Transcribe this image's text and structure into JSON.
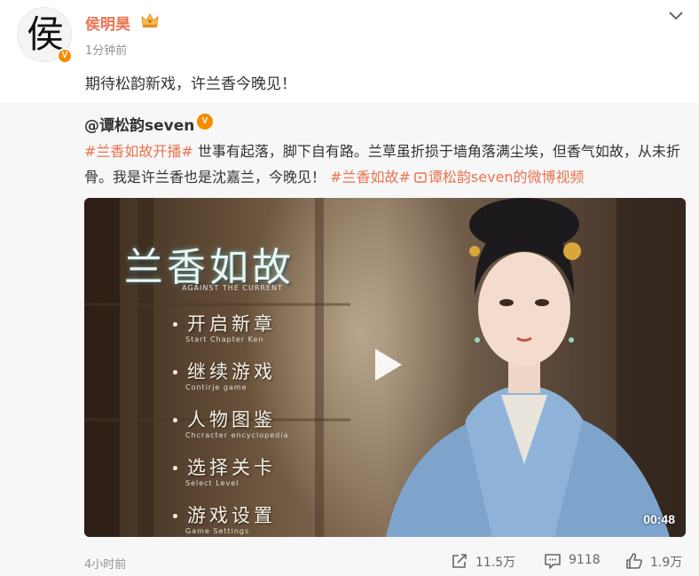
{
  "post": {
    "avatar_char": "侯",
    "author": "侯明昊",
    "verified_badge": "V",
    "time": "1分钟前",
    "text": "期待松韵新戏，许兰香今晚见！"
  },
  "repost": {
    "author": "@谭松韵seven",
    "verified_badge": "V",
    "topic1": "#兰香如故开播#",
    "body": " 世事有起落，脚下自有路。兰草虽折损于墙角落满尘埃，但香气如故，从未折骨。我是许兰香也是沈嘉兰，今晚见！ ",
    "topic2": "#兰香如故#",
    "video_link": "谭松韵seven的微博视频",
    "video": {
      "title": "兰香如故",
      "subtitle": "AGAINST THE CURRENT",
      "menu": [
        {
          "label": "开启新章",
          "sub": "Start Chapter Ken"
        },
        {
          "label": "继续游戏",
          "sub": "Contirje game"
        },
        {
          "label": "人物图鉴",
          "sub": "Chcracter encyclopedia"
        },
        {
          "label": "选择关卡",
          "sub": "Select Level"
        },
        {
          "label": "游戏设置",
          "sub": "Game Settings"
        }
      ],
      "duration": "00:48"
    },
    "time": "4小时前",
    "stats": {
      "reposts": "11.5万",
      "comments": "9118",
      "likes": "1.9万"
    }
  },
  "colors": {
    "accent": "#eb7350",
    "badge": "#f78b00",
    "repost_bg": "#f7f7f7"
  },
  "icons": [
    "crown-icon",
    "chevron-down-icon",
    "video-link-icon",
    "play-icon",
    "share-icon",
    "comment-icon",
    "like-icon"
  ]
}
